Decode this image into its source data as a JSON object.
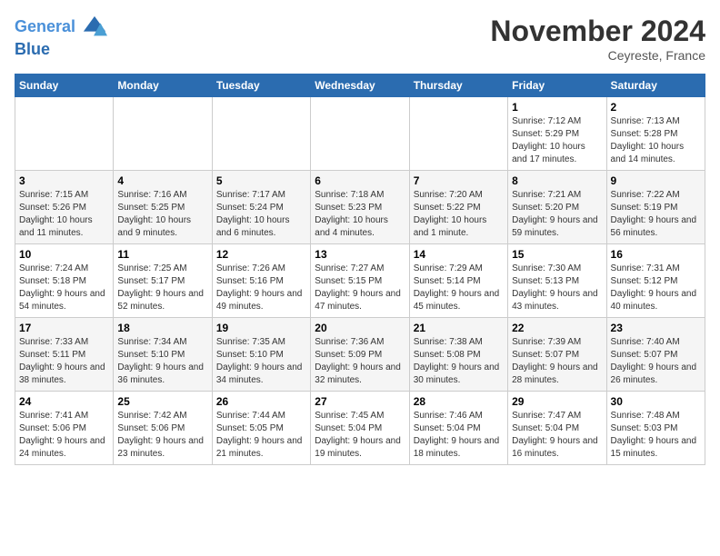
{
  "header": {
    "logo_line1": "General",
    "logo_line2": "Blue",
    "month": "November 2024",
    "location": "Ceyreste, France"
  },
  "columns": [
    "Sunday",
    "Monday",
    "Tuesday",
    "Wednesday",
    "Thursday",
    "Friday",
    "Saturday"
  ],
  "weeks": [
    {
      "days": [
        {
          "num": "",
          "info": ""
        },
        {
          "num": "",
          "info": ""
        },
        {
          "num": "",
          "info": ""
        },
        {
          "num": "",
          "info": ""
        },
        {
          "num": "",
          "info": ""
        },
        {
          "num": "1",
          "info": "Sunrise: 7:12 AM\nSunset: 5:29 PM\nDaylight: 10 hours and 17 minutes."
        },
        {
          "num": "2",
          "info": "Sunrise: 7:13 AM\nSunset: 5:28 PM\nDaylight: 10 hours and 14 minutes."
        }
      ]
    },
    {
      "days": [
        {
          "num": "3",
          "info": "Sunrise: 7:15 AM\nSunset: 5:26 PM\nDaylight: 10 hours and 11 minutes."
        },
        {
          "num": "4",
          "info": "Sunrise: 7:16 AM\nSunset: 5:25 PM\nDaylight: 10 hours and 9 minutes."
        },
        {
          "num": "5",
          "info": "Sunrise: 7:17 AM\nSunset: 5:24 PM\nDaylight: 10 hours and 6 minutes."
        },
        {
          "num": "6",
          "info": "Sunrise: 7:18 AM\nSunset: 5:23 PM\nDaylight: 10 hours and 4 minutes."
        },
        {
          "num": "7",
          "info": "Sunrise: 7:20 AM\nSunset: 5:22 PM\nDaylight: 10 hours and 1 minute."
        },
        {
          "num": "8",
          "info": "Sunrise: 7:21 AM\nSunset: 5:20 PM\nDaylight: 9 hours and 59 minutes."
        },
        {
          "num": "9",
          "info": "Sunrise: 7:22 AM\nSunset: 5:19 PM\nDaylight: 9 hours and 56 minutes."
        }
      ]
    },
    {
      "days": [
        {
          "num": "10",
          "info": "Sunrise: 7:24 AM\nSunset: 5:18 PM\nDaylight: 9 hours and 54 minutes."
        },
        {
          "num": "11",
          "info": "Sunrise: 7:25 AM\nSunset: 5:17 PM\nDaylight: 9 hours and 52 minutes."
        },
        {
          "num": "12",
          "info": "Sunrise: 7:26 AM\nSunset: 5:16 PM\nDaylight: 9 hours and 49 minutes."
        },
        {
          "num": "13",
          "info": "Sunrise: 7:27 AM\nSunset: 5:15 PM\nDaylight: 9 hours and 47 minutes."
        },
        {
          "num": "14",
          "info": "Sunrise: 7:29 AM\nSunset: 5:14 PM\nDaylight: 9 hours and 45 minutes."
        },
        {
          "num": "15",
          "info": "Sunrise: 7:30 AM\nSunset: 5:13 PM\nDaylight: 9 hours and 43 minutes."
        },
        {
          "num": "16",
          "info": "Sunrise: 7:31 AM\nSunset: 5:12 PM\nDaylight: 9 hours and 40 minutes."
        }
      ]
    },
    {
      "days": [
        {
          "num": "17",
          "info": "Sunrise: 7:33 AM\nSunset: 5:11 PM\nDaylight: 9 hours and 38 minutes."
        },
        {
          "num": "18",
          "info": "Sunrise: 7:34 AM\nSunset: 5:10 PM\nDaylight: 9 hours and 36 minutes."
        },
        {
          "num": "19",
          "info": "Sunrise: 7:35 AM\nSunset: 5:10 PM\nDaylight: 9 hours and 34 minutes."
        },
        {
          "num": "20",
          "info": "Sunrise: 7:36 AM\nSunset: 5:09 PM\nDaylight: 9 hours and 32 minutes."
        },
        {
          "num": "21",
          "info": "Sunrise: 7:38 AM\nSunset: 5:08 PM\nDaylight: 9 hours and 30 minutes."
        },
        {
          "num": "22",
          "info": "Sunrise: 7:39 AM\nSunset: 5:07 PM\nDaylight: 9 hours and 28 minutes."
        },
        {
          "num": "23",
          "info": "Sunrise: 7:40 AM\nSunset: 5:07 PM\nDaylight: 9 hours and 26 minutes."
        }
      ]
    },
    {
      "days": [
        {
          "num": "24",
          "info": "Sunrise: 7:41 AM\nSunset: 5:06 PM\nDaylight: 9 hours and 24 minutes."
        },
        {
          "num": "25",
          "info": "Sunrise: 7:42 AM\nSunset: 5:06 PM\nDaylight: 9 hours and 23 minutes."
        },
        {
          "num": "26",
          "info": "Sunrise: 7:44 AM\nSunset: 5:05 PM\nDaylight: 9 hours and 21 minutes."
        },
        {
          "num": "27",
          "info": "Sunrise: 7:45 AM\nSunset: 5:04 PM\nDaylight: 9 hours and 19 minutes."
        },
        {
          "num": "28",
          "info": "Sunrise: 7:46 AM\nSunset: 5:04 PM\nDaylight: 9 hours and 18 minutes."
        },
        {
          "num": "29",
          "info": "Sunrise: 7:47 AM\nSunset: 5:04 PM\nDaylight: 9 hours and 16 minutes."
        },
        {
          "num": "30",
          "info": "Sunrise: 7:48 AM\nSunset: 5:03 PM\nDaylight: 9 hours and 15 minutes."
        }
      ]
    }
  ]
}
